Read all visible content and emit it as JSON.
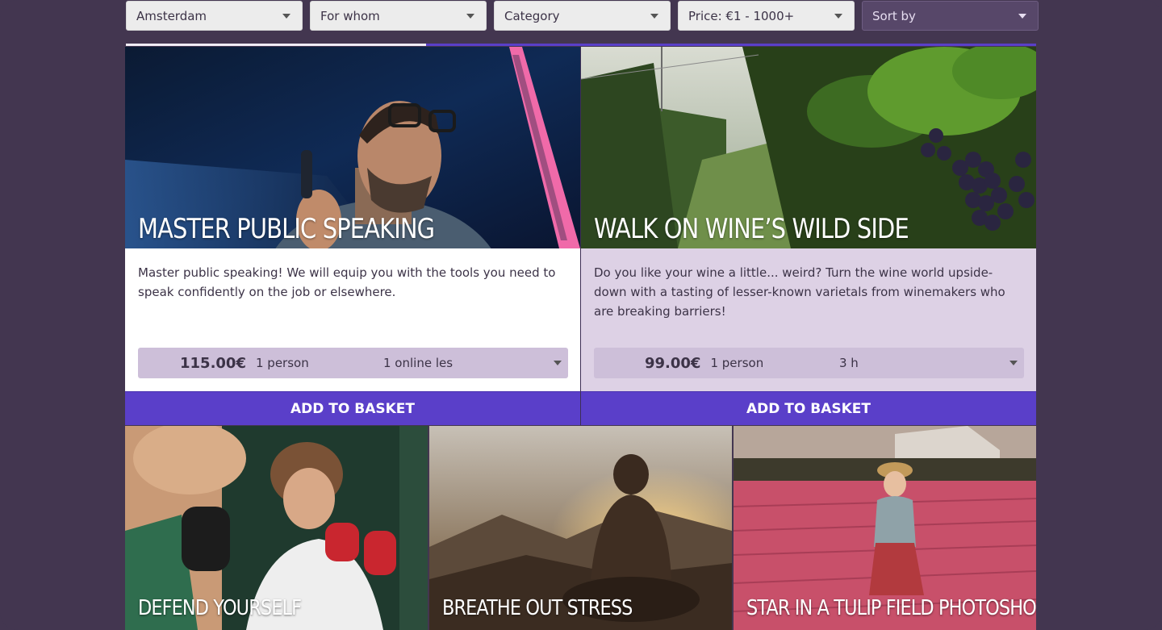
{
  "filters": [
    {
      "label": "Amsterdam"
    },
    {
      "label": "For whom"
    },
    {
      "label": "Category"
    },
    {
      "label": "Price: €1 - 1000+"
    },
    {
      "label": "Sort by"
    }
  ],
  "scroll_progress": 0.33,
  "featured": [
    {
      "title": "Master public speaking",
      "description": "Master public speaking! We will equip you with the tools you need to speak confidently on the job or elsewhere.",
      "price": "115.00€",
      "persons": "1 person",
      "duration": "1 online les",
      "basket_label": "Add to basket"
    },
    {
      "title": "Walk on wine’s wild side",
      "description": "Do you like your wine a little... weird? Turn the wine world upside-down with a tasting of lesser-known varietals from winemakers who are breaking barriers!",
      "price": "99.00€",
      "persons": "1 person",
      "duration": "3 h",
      "basket_label": "Add to basket"
    }
  ],
  "cards": [
    {
      "title": "Defend yourself"
    },
    {
      "title": "Breathe out stress"
    },
    {
      "title": "Star in a tulip field photoshoot"
    }
  ],
  "colors": {
    "background": "#433650",
    "accent": "#5a3fc9",
    "lilac_card": "#ddd1e5",
    "price_row": "#cdbfd9"
  }
}
